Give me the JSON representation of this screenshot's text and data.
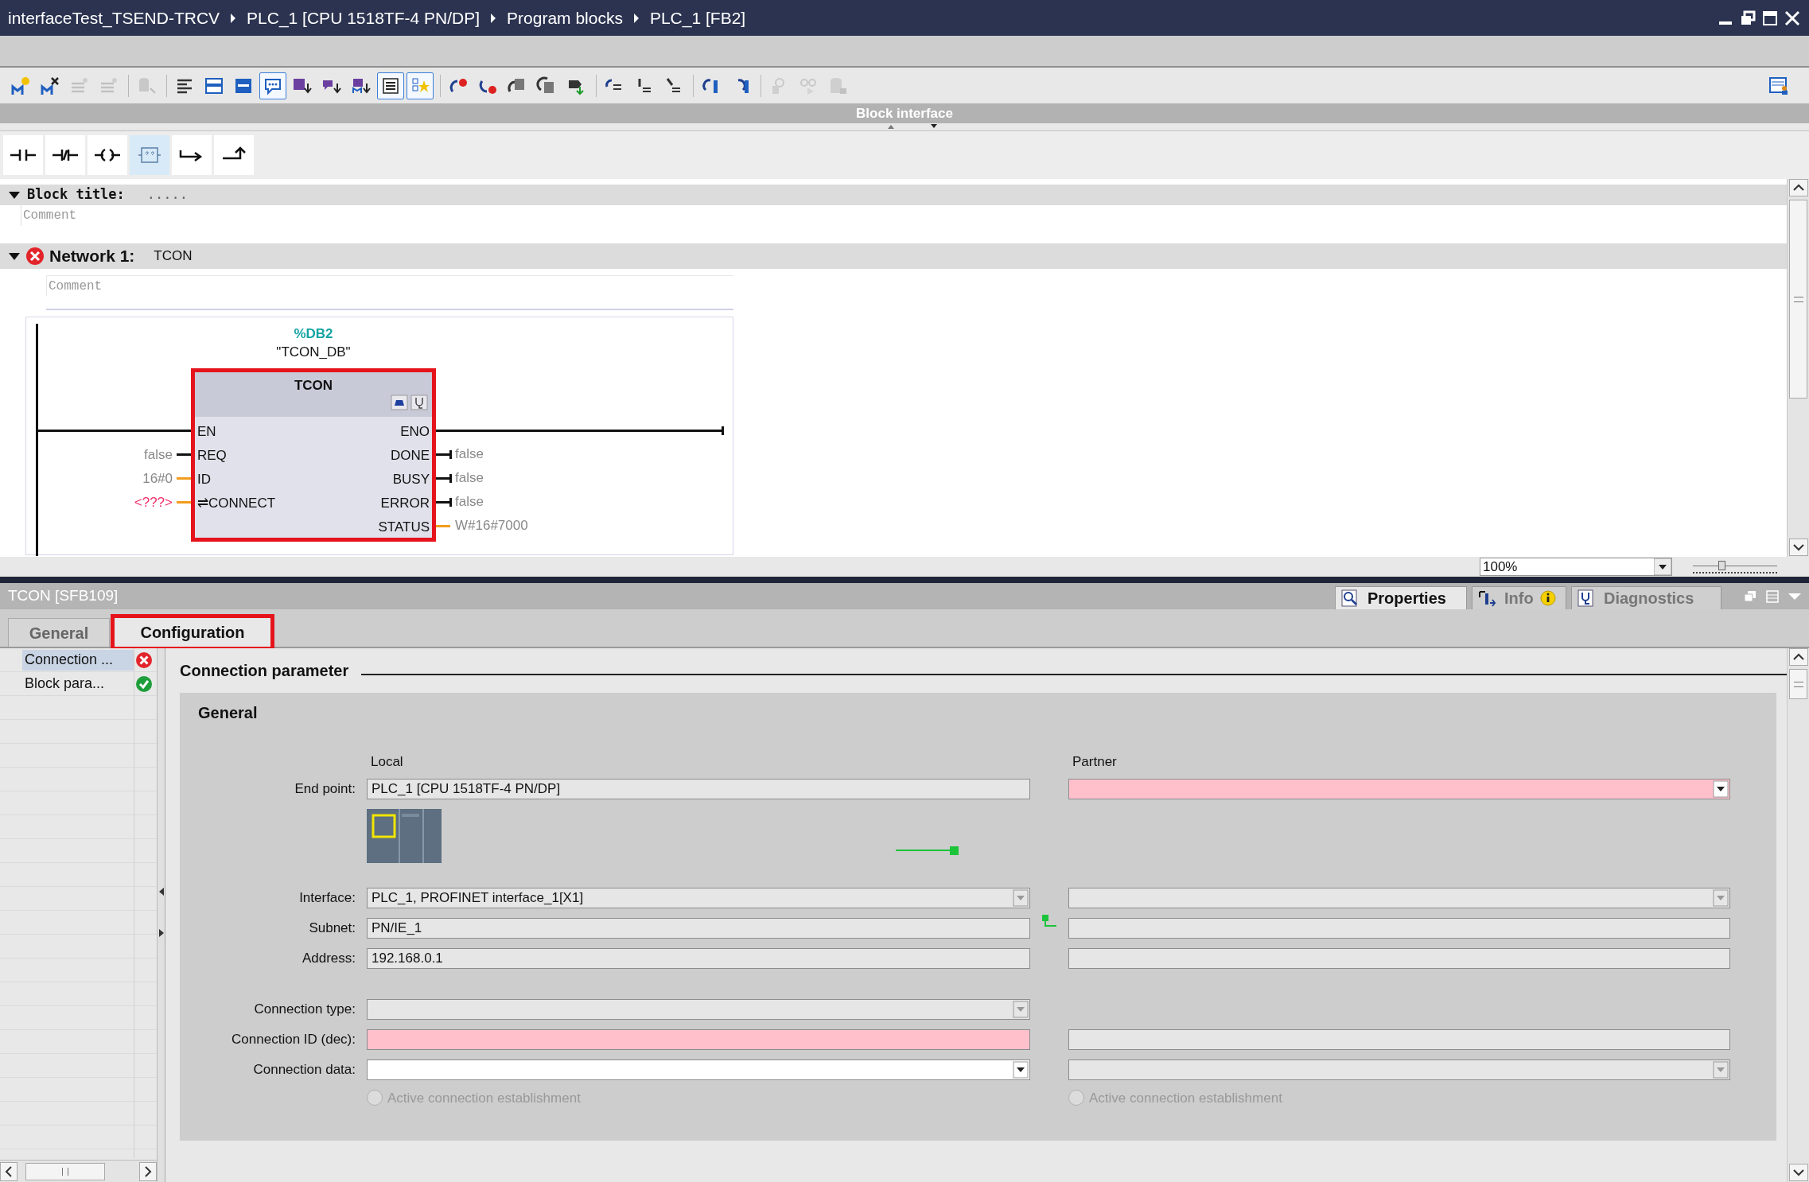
{
  "window": {
    "breadcrumb": [
      "interfaceTest_TSEND-TRCV",
      "PLC_1 [CPU 1518TF-4 PN/DP]",
      "Program blocks",
      "PLC_1 [FB2]"
    ]
  },
  "toolbar_buttons": [
    {
      "selected": false,
      "disabled": false
    },
    {
      "selected": false,
      "disabled": false
    },
    {
      "selected": false,
      "disabled": true
    },
    {
      "selected": false,
      "disabled": true
    },
    {
      "selected": false,
      "disabled": true
    },
    {
      "selected": false,
      "disabled": false
    },
    {
      "selected": false,
      "disabled": false
    },
    {
      "selected": false,
      "disabled": false
    },
    {
      "selected": true,
      "disabled": false
    },
    {
      "selected": false,
      "disabled": false
    },
    {
      "selected": false,
      "disabled": false
    },
    {
      "selected": false,
      "disabled": false
    },
    {
      "selected": true,
      "disabled": false
    },
    {
      "selected": true,
      "disabled": false
    },
    {
      "selected": false,
      "disabled": false
    },
    {
      "selected": false,
      "disabled": false
    },
    {
      "selected": false,
      "disabled": false
    },
    {
      "selected": false,
      "disabled": false
    },
    {
      "selected": false,
      "disabled": false
    },
    {
      "selected": false,
      "disabled": false
    },
    {
      "selected": false,
      "disabled": false
    },
    {
      "selected": false,
      "disabled": false
    },
    {
      "selected": false,
      "disabled": false
    },
    {
      "selected": false,
      "disabled": false
    },
    {
      "selected": false,
      "disabled": true
    },
    {
      "selected": false,
      "disabled": true
    },
    {
      "selected": false,
      "disabled": true
    }
  ],
  "block_interface": {
    "label": "Block interface"
  },
  "instruction_palette": [
    {
      "selected": false
    },
    {
      "selected": false
    },
    {
      "selected": false
    },
    {
      "selected": true
    },
    {
      "selected": false
    },
    {
      "selected": false
    }
  ],
  "block_title": {
    "label": "Block title:",
    "value": ".....",
    "comment": "Comment"
  },
  "network": {
    "label": "Network 1:",
    "title": "TCON",
    "error": true,
    "comment": "Comment",
    "instance": {
      "address": "%DB2",
      "name": "\"TCON_DB\""
    },
    "block": {
      "name": "TCON",
      "highlighted": true,
      "inputs": [
        {
          "pin": "EN",
          "kind": "power"
        },
        {
          "pin": "REQ",
          "value": "false",
          "kind": "bool",
          "invalid": false
        },
        {
          "pin": "ID",
          "value": "16#0",
          "kind": "word",
          "invalid": false
        },
        {
          "pin": "⇌CONNECT",
          "value": "<???>",
          "kind": "word",
          "invalid": true
        }
      ],
      "outputs": [
        {
          "pin": "ENO",
          "kind": "power"
        },
        {
          "pin": "DONE",
          "value": "false",
          "kind": "bool"
        },
        {
          "pin": "BUSY",
          "value": "false",
          "kind": "bool"
        },
        {
          "pin": "ERROR",
          "value": "false",
          "kind": "bool"
        },
        {
          "pin": "STATUS",
          "value": "W#16#7000",
          "kind": "word"
        }
      ]
    }
  },
  "zoom": {
    "value": "100%",
    "level": 0.36
  },
  "inspector": {
    "title": "TCON [SFB109]",
    "panel_tabs": [
      {
        "label": "Properties",
        "selected": true
      },
      {
        "label": "Info",
        "selected": false,
        "info": true
      },
      {
        "label": "Diagnostics",
        "selected": false
      }
    ],
    "tabs": [
      {
        "label": "General",
        "selected": false,
        "highlighted": false
      },
      {
        "label": "Configuration",
        "selected": true,
        "highlighted": true
      }
    ],
    "nav": [
      {
        "label": "Connection ...",
        "selected": true,
        "error": true
      },
      {
        "label": "Block para...",
        "selected": false,
        "error": false
      }
    ],
    "section": "Connection parameter",
    "group": "General",
    "local_heading": "Local",
    "partner_heading": "Partner",
    "rows": [
      {
        "label": "End point:",
        "connected": false,
        "local": {
          "kind": "text",
          "readonly": true,
          "invalid": false,
          "value": "PLC_1 [CPU 1518TF-4 PN/DP]"
        },
        "partner": {
          "kind": "dropdown",
          "invalid": true
        }
      },
      {
        "label": "Interface:",
        "connected": false,
        "local": {
          "kind": "dropdown",
          "readonly": true,
          "invalid": false,
          "value": "PLC_1, PROFINET interface_1[X1]"
        },
        "partner": {
          "kind": "dropdown",
          "readonly": true,
          "invalid": false
        }
      },
      {
        "label": "Subnet:",
        "connected": true,
        "local": {
          "kind": "text",
          "readonly": true,
          "invalid": false,
          "value": "PN/IE_1"
        },
        "partner": {
          "kind": "text",
          "readonly": true,
          "invalid": false
        }
      },
      {
        "label": "Address:",
        "connected": false,
        "local": {
          "kind": "text",
          "readonly": true,
          "invalid": false,
          "value": "192.168.0.1"
        },
        "partner": {
          "kind": "text",
          "readonly": true,
          "invalid": false
        }
      },
      {
        "label": "Connection type:",
        "connected": false,
        "local": {
          "kind": "dropdown",
          "readonly": true,
          "invalid": false
        }
      },
      {
        "label": "Connection ID (dec):",
        "connected": false,
        "local": {
          "kind": "text",
          "invalid": true
        },
        "partner": {
          "kind": "text",
          "readonly": true,
          "invalid": false
        }
      },
      {
        "label": "Connection data:",
        "connected": false,
        "local": {
          "kind": "dropdown",
          "readonly": false,
          "invalid": false
        },
        "partner": {
          "kind": "dropdown",
          "readonly": true,
          "invalid": false
        }
      }
    ],
    "active_connection": {
      "local": {
        "label": "Active connection establishment",
        "checked": false,
        "disabled": true
      },
      "partner": {
        "label": "Active connection establishment",
        "checked": false,
        "disabled": true
      }
    }
  }
}
